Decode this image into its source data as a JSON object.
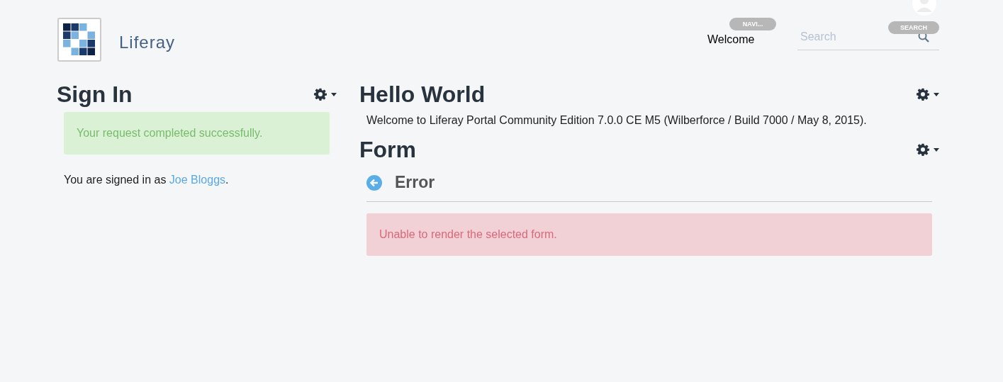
{
  "header": {
    "site_name": "Liferay",
    "nav_badge": "NAVI...",
    "nav_link": "Welcome",
    "search": {
      "placeholder": "Search",
      "badge": "SEARCH"
    }
  },
  "columns": [
    {
      "portlets": [
        {
          "title": "Sign In",
          "body": [
            {
              "kind": "success-alert",
              "text": "Your request completed successfully."
            },
            {
              "kind": "signed-in",
              "text": "You are signed in as ",
              "link": "Joe Bloggs",
              "suffix": "."
            }
          ]
        }
      ]
    },
    {
      "portlets": [
        {
          "title": "Hello World",
          "body": [
            {
              "kind": "text",
              "text": "Welcome to Liferay Portal Community Edition 7.0.0 CE M5 (Wilberforce / Build 7000 / May 8, 2015)."
            }
          ]
        },
        {
          "title": "Form",
          "body": [
            {
              "kind": "back-header",
              "text": "Error"
            },
            {
              "kind": "error-alert",
              "text": "Unable to render the selected form."
            }
          ]
        }
      ]
    }
  ]
}
